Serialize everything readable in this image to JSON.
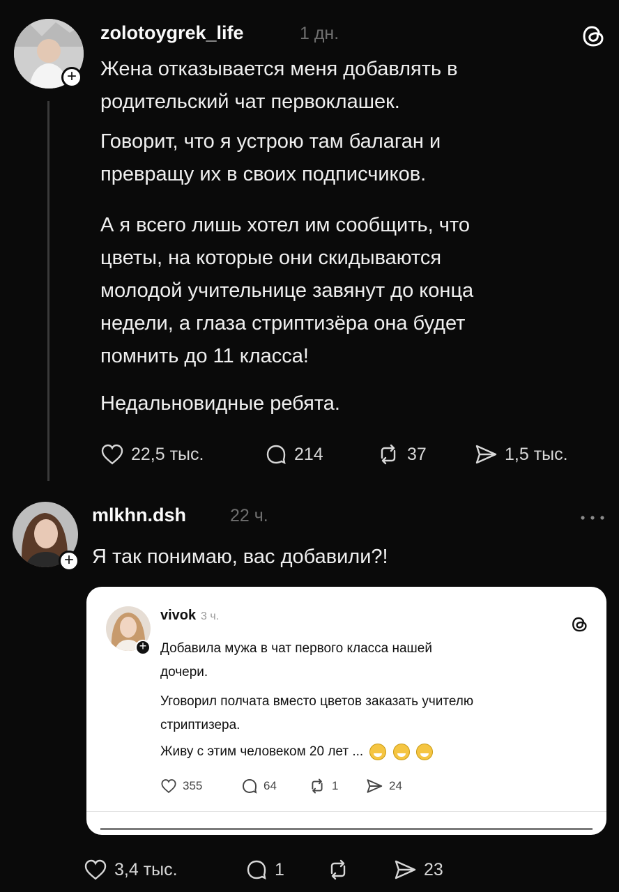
{
  "post1": {
    "username": "zolotoygrek_life",
    "time": "1 дн.",
    "paragraphs": [
      [
        "Жена отказывается меня добавлять в",
        "родительский чат первоклашек."
      ],
      [
        "Говорит, что я устрою там балаган и",
        "превращу их в своих подписчиков."
      ],
      [
        "А я всего лишь хотел им сообщить, что",
        "цветы, на которые они скидываются",
        "молодой учительнице завянут до конца",
        "недели, а глаза стриптизёра она будет",
        "помнить до 11 класса!"
      ],
      [
        "Недальновидные ребята."
      ]
    ],
    "likes": "22,5 тыс.",
    "comments": "214",
    "reposts": "37",
    "shares": "1,5 тыс."
  },
  "post2": {
    "username": "mlkhn.dsh",
    "time": "22 ч.",
    "text": "Я так понимаю, вас добавили?!",
    "likes": "3,4 тыс.",
    "comments": "1",
    "shares": "23"
  },
  "quoted": {
    "username": "vivok",
    "time": "3 ч.",
    "lines": [
      "Добавила мужа в чат первого класса нашей",
      "дочери.",
      "Уговорил полчата вместо цветов заказать учителю",
      "стриптизера.",
      "Живу с этим человеком 20 лет ..."
    ],
    "likes": "355",
    "comments": "64",
    "reposts": "1",
    "shares": "24"
  },
  "icons": {
    "threads_logo": "threads-logo-icon",
    "more": "more-icon",
    "like": "heart-icon",
    "comment": "comment-icon",
    "repost": "repost-icon",
    "share": "send-icon",
    "emoji": "sweat-smile-emoji"
  },
  "colors": {
    "background": "#0a0a0a",
    "text": "#f2f2f2",
    "muted": "#6f6f6f",
    "card": "#ffffff"
  }
}
